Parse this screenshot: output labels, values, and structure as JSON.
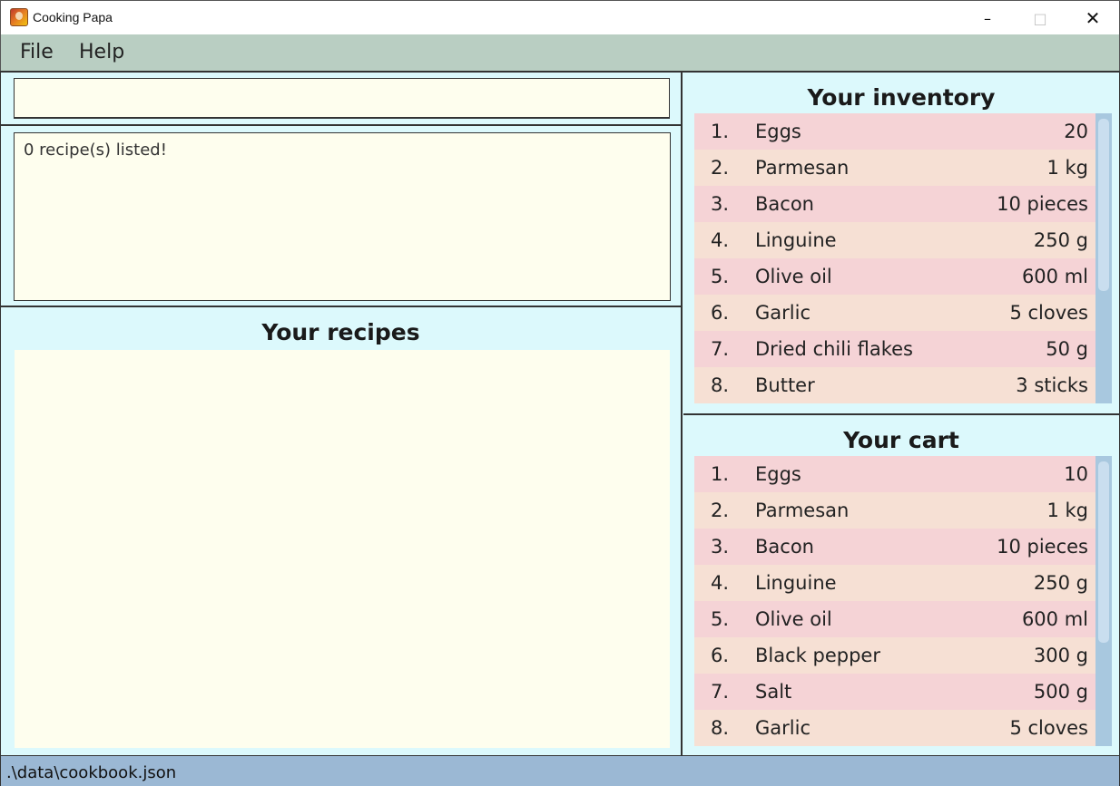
{
  "window": {
    "title": "Cooking Papa",
    "minimize_glyph": "–",
    "maximize_glyph": "□",
    "close_glyph": "✕"
  },
  "menu": {
    "items": [
      "File",
      "Help"
    ]
  },
  "command": {
    "value": "",
    "placeholder": ""
  },
  "result": {
    "message": "0 recipe(s) listed!"
  },
  "recipes": {
    "title": "Your recipes",
    "items": []
  },
  "inventory": {
    "title": "Your inventory",
    "items": [
      {
        "index": "1.",
        "name": "Eggs",
        "quantity": "20"
      },
      {
        "index": "2.",
        "name": "Parmesan",
        "quantity": "1 kg"
      },
      {
        "index": "3.",
        "name": "Bacon",
        "quantity": "10 pieces"
      },
      {
        "index": "4.",
        "name": "Linguine",
        "quantity": "250 g"
      },
      {
        "index": "5.",
        "name": "Olive oil",
        "quantity": "600 ml"
      },
      {
        "index": "6.",
        "name": "Garlic",
        "quantity": "5 cloves"
      },
      {
        "index": "7.",
        "name": "Dried chili flakes",
        "quantity": "50 g"
      },
      {
        "index": "8.",
        "name": "Butter",
        "quantity": "3 sticks"
      }
    ]
  },
  "cart": {
    "title": "Your cart",
    "items": [
      {
        "index": "1.",
        "name": "Eggs",
        "quantity": "10"
      },
      {
        "index": "2.",
        "name": "Parmesan",
        "quantity": "1 kg"
      },
      {
        "index": "3.",
        "name": "Bacon",
        "quantity": "10 pieces"
      },
      {
        "index": "4.",
        "name": "Linguine",
        "quantity": "250 g"
      },
      {
        "index": "5.",
        "name": "Olive oil",
        "quantity": "600 ml"
      },
      {
        "index": "6.",
        "name": "Black pepper",
        "quantity": "300 g"
      },
      {
        "index": "7.",
        "name": "Salt",
        "quantity": "500 g"
      },
      {
        "index": "8.",
        "name": "Garlic",
        "quantity": "5 cloves"
      }
    ]
  },
  "status": {
    "file_path": ".\\data\\cookbook.json"
  },
  "colors": {
    "menubar": "#b9cec2",
    "panel_bg": "#dcf9fc",
    "input_bg": "#fefeee",
    "row_odd": "#f5d3d6",
    "row_even": "#f6e0d4",
    "scrollbar": "#a8c8df",
    "statusbar": "#9bb8d4"
  }
}
